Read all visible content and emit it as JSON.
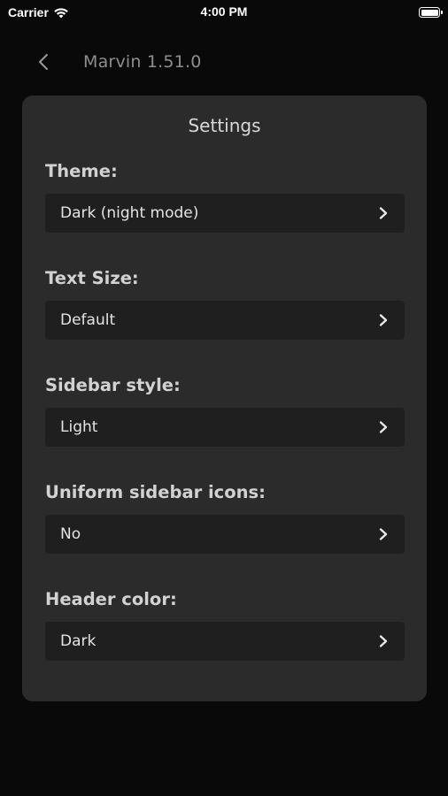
{
  "status_bar": {
    "carrier": "Carrier",
    "time": "4:00 PM"
  },
  "nav": {
    "title": "Marvin 1.51.0"
  },
  "settings": {
    "title": "Settings",
    "items": [
      {
        "label": "Theme:",
        "value": "Dark (night mode)"
      },
      {
        "label": "Text Size:",
        "value": "Default"
      },
      {
        "label": "Sidebar style:",
        "value": "Light"
      },
      {
        "label": "Uniform sidebar icons:",
        "value": "No"
      },
      {
        "label": "Header color:",
        "value": "Dark"
      }
    ]
  },
  "icons": {
    "back": "chevron-left-icon",
    "row_chevron": "chevron-right-icon",
    "wifi": "wifi-icon",
    "battery": "battery-icon"
  },
  "colors": {
    "background": "#090909",
    "card": "#2b2b2b",
    "select": "#1f1f1f",
    "label": "#d2d2d2",
    "muted_title": "#8e8e8e"
  }
}
